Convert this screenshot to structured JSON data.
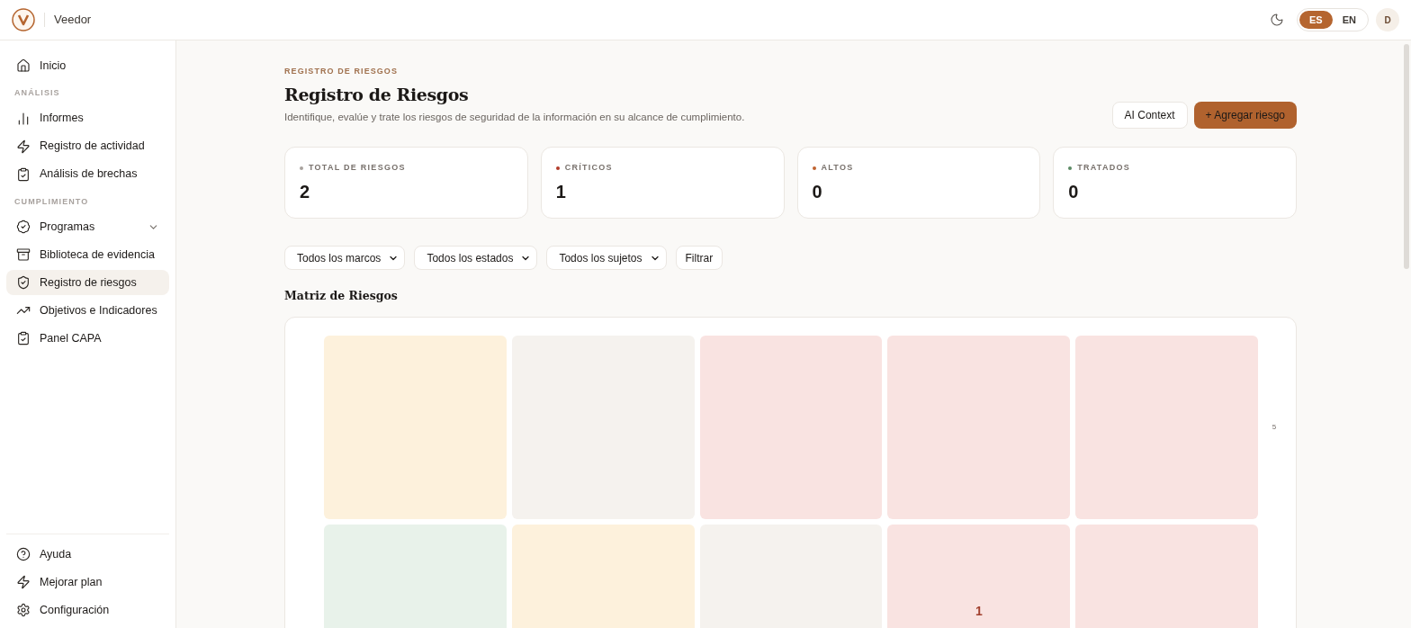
{
  "header": {
    "brand": "Veedor",
    "languages": [
      {
        "label": "ES",
        "selected": true
      },
      {
        "label": "EN",
        "selected": false
      }
    ],
    "avatar": "D"
  },
  "sidebar": {
    "sections": [
      {
        "items": [
          {
            "label": "Inicio",
            "kind": "home",
            "selected": false
          }
        ]
      },
      {
        "heading": "ANÁLISIS",
        "items": [
          {
            "label": "Informes",
            "kind": "chart",
            "selected": false
          },
          {
            "label": "Registro de actividad",
            "kind": "zap",
            "selected": false
          },
          {
            "label": "Análisis de brechas",
            "kind": "clipboard",
            "selected": false
          }
        ]
      },
      {
        "heading": "CUMPLIMIENTO",
        "items": [
          {
            "label": "Programas",
            "kind": "badge",
            "selected": false,
            "expandable": true
          },
          {
            "label": "Biblioteca de evidencia",
            "kind": "archive",
            "selected": false
          },
          {
            "label": "Registro de riesgos",
            "kind": "shield",
            "selected": true
          },
          {
            "label": "Objetivos e Indicadores",
            "kind": "trend",
            "selected": false
          },
          {
            "label": "Panel CAPA",
            "kind": "clipboard",
            "selected": false
          }
        ]
      }
    ],
    "footer": [
      {
        "label": "Ayuda",
        "kind": "help"
      },
      {
        "label": "Mejorar plan",
        "kind": "zap"
      },
      {
        "label": "Configuración",
        "kind": "gear"
      }
    ]
  },
  "page": {
    "eyebrow": "REGISTRO DE RIESGOS",
    "title": "Registro de Riesgos",
    "subtitle": "Identifique, evalúe y trate los riesgos de seguridad de la información en su alcance de cumplimiento.",
    "buttons": [
      {
        "label": "AI Context",
        "kind": "secondary"
      },
      {
        "label": "+ Agregar riesgo",
        "kind": "primary"
      }
    ]
  },
  "stats": [
    {
      "label": "TOTAL DE RIESGOS",
      "value": "2",
      "color": "#a8a29e"
    },
    {
      "label": "CRÍTICOS",
      "value": "1",
      "color": "#b23b2a"
    },
    {
      "label": "ALTOS",
      "value": "0",
      "color": "#c0622f"
    },
    {
      "label": "TRATADOS",
      "value": "0",
      "color": "#5a8a64"
    }
  ],
  "filters": {
    "selects": [
      "Todos los marcos",
      "Todos los estados",
      "Todos los sujetos"
    ],
    "button": "Filtrar"
  },
  "matrix": {
    "title": "Matriz de Riesgos",
    "rows": [
      {
        "label": "5",
        "cells": [
          {
            "color": "#fdf1dc"
          },
          {
            "color": "#f5f2ee"
          },
          {
            "color": "#f9e3e1"
          },
          {
            "color": "#f9e3e1"
          },
          {
            "color": "#f9e3e1"
          }
        ]
      },
      {
        "cells": [
          {
            "color": "#e8f2ea"
          },
          {
            "color": "#fdf1dc"
          },
          {
            "color": "#f5f2ee"
          },
          {
            "color": "#f9e3e1",
            "count": "1"
          },
          {
            "color": "#f9e3e1"
          }
        ]
      }
    ]
  }
}
